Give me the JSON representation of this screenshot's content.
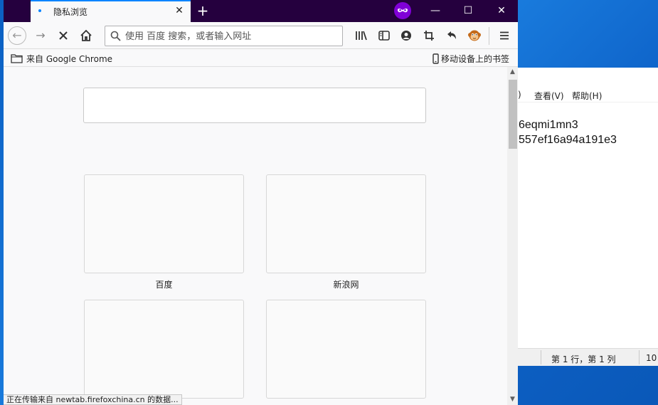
{
  "browser": {
    "tab": {
      "title": "隐私浏览",
      "close_glyph": "✕"
    },
    "newtab_glyph": "+",
    "window_controls": {
      "minimize": "—",
      "maximize": "☐",
      "close": "✕"
    },
    "urlbar": {
      "placeholder": "使用 百度 搜索，或者输入网址",
      "value": ""
    },
    "bookmarks": {
      "folder": "来自 Google Chrome",
      "mobile": "移动设备上的书签"
    },
    "tiles": [
      {
        "label": "百度"
      },
      {
        "label": "新浪网"
      },
      {
        "label": ""
      },
      {
        "label": ""
      }
    ],
    "status_text": "正在传输来自 newtab.firefoxchina.cn 的数据..."
  },
  "notepad": {
    "menus": [
      ")",
      "查看(V)",
      "帮助(H)"
    ],
    "lines": [
      "6eqmi1mn3",
      "557ef16a94a191e3"
    ],
    "status": {
      "position": "第 1 行，第 1 列",
      "extra": "10"
    }
  },
  "colors": {
    "titlebar": "#25003e",
    "accent": "#0a84ff",
    "private": "#8000d7",
    "desktop": "#1b7fe0"
  },
  "icons": [
    "back-icon",
    "forward-icon",
    "stop-icon",
    "home-icon",
    "search-icon",
    "library-icon",
    "sidebar-icon",
    "account-icon",
    "screenshot-icon",
    "undo-icon",
    "monkey-icon",
    "menu-icon",
    "folder-icon",
    "mobile-icon",
    "private-browsing-icon"
  ]
}
